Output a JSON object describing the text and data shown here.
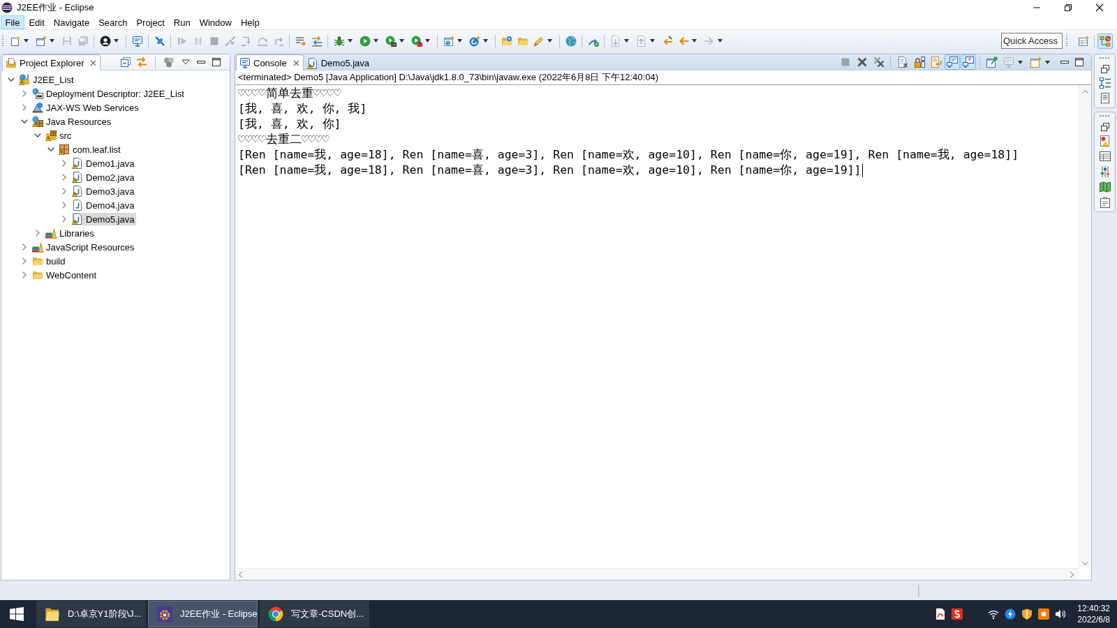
{
  "window": {
    "title": "J2EE作业 - Eclipse"
  },
  "menu": [
    {
      "label": "File",
      "selected": true
    },
    {
      "label": "Edit",
      "selected": false
    },
    {
      "label": "Navigate",
      "selected": false
    },
    {
      "label": "Search",
      "selected": false
    },
    {
      "label": "Project",
      "selected": false
    },
    {
      "label": "Run",
      "selected": false
    },
    {
      "label": "Window",
      "selected": false
    },
    {
      "label": "Help",
      "selected": false
    }
  ],
  "toolbar": {
    "buttons": [
      {
        "disabled": false
      },
      {
        "disabled": false
      },
      {
        "disabled": true
      },
      {
        "disabled": true
      },
      {
        "disabled": false
      },
      {
        "disabled": false
      },
      {
        "disabled": false
      },
      {
        "disabled": true
      },
      {
        "disabled": true
      },
      {
        "disabled": true
      },
      {
        "disabled": true
      },
      {
        "disabled": true
      },
      {
        "disabled": true
      },
      {
        "disabled": true
      },
      {
        "disabled": false
      },
      {
        "disabled": false
      },
      {
        "disabled": false
      },
      {
        "disabled": false
      },
      {
        "disabled": false
      },
      {
        "disabled": false
      },
      {
        "disabled": false
      },
      {
        "disabled": false
      },
      {
        "disabled": false
      },
      {
        "disabled": false
      },
      {
        "disabled": false
      },
      {
        "disabled": false
      },
      {
        "disabled": false
      },
      {
        "disabled": true
      },
      {
        "disabled": true
      },
      {
        "disabled": false
      },
      {
        "disabled": false
      },
      {
        "disabled": true
      }
    ],
    "quick_access": {
      "placeholder": "Quick Access"
    },
    "perspectives": [
      {
        "selected": false
      },
      {
        "selected": true
      }
    ]
  },
  "project_explorer": {
    "tabs": [
      {
        "label": "Project Explorer",
        "kind": "explorer",
        "warning": false,
        "selected": true
      }
    ],
    "tree": [
      {
        "label": "J2EE_List",
        "kind": "project",
        "warning": true,
        "expanded": true,
        "selected": false,
        "children": [
          {
            "label": "Deployment Descriptor: J2EE_List",
            "kind": "descriptor",
            "warning": false,
            "expanded": false,
            "selected": false
          },
          {
            "label": "JAX-WS Web Services",
            "kind": "services",
            "warning": false,
            "expanded": false,
            "selected": false
          },
          {
            "label": "Java Resources",
            "kind": "resources",
            "warning": true,
            "expanded": true,
            "selected": false,
            "children": [
              {
                "label": "src",
                "kind": "source",
                "warning": true,
                "expanded": true,
                "selected": false,
                "children": [
                  {
                    "label": "com.leaf.list",
                    "kind": "package",
                    "warning": true,
                    "expanded": true,
                    "selected": false,
                    "children": [
                      {
                        "label": "Demo1.java",
                        "kind": "file",
                        "warning": true,
                        "expanded": false,
                        "selected": false
                      },
                      {
                        "label": "Demo2.java",
                        "kind": "file",
                        "warning": true,
                        "expanded": false,
                        "selected": false
                      },
                      {
                        "label": "Demo3.java",
                        "kind": "file",
                        "warning": true,
                        "expanded": false,
                        "selected": false
                      },
                      {
                        "label": "Demo4.java",
                        "kind": "file",
                        "warning": false,
                        "expanded": false,
                        "selected": false
                      },
                      {
                        "label": "Demo5.java",
                        "kind": "file",
                        "warning": true,
                        "expanded": false,
                        "selected": true
                      }
                    ]
                  }
                ]
              },
              {
                "label": "Libraries",
                "kind": "library",
                "warning": false,
                "expanded": false,
                "selected": false
              }
            ]
          },
          {
            "label": "JavaScript Resources",
            "kind": "library",
            "warning": false,
            "expanded": false,
            "selected": false
          },
          {
            "label": "build",
            "kind": "folder",
            "warning": false,
            "expanded": false,
            "selected": false
          },
          {
            "label": "WebContent",
            "kind": "folder",
            "warning": false,
            "expanded": false,
            "selected": false
          }
        ]
      }
    ]
  },
  "console": {
    "tabs": [
      {
        "label": "Console",
        "kind": "console",
        "warning": false,
        "selected": true
      },
      {
        "label": "Demo5.java",
        "kind": "file",
        "warning": true,
        "selected": false
      }
    ],
    "toolbar": [
      {
        "disabled": true,
        "on": false
      },
      {
        "disabled": false,
        "on": false
      },
      {
        "disabled": false,
        "on": false
      },
      {
        "disabled": false,
        "on": false
      },
      {
        "disabled": false,
        "on": false
      },
      {
        "disabled": false,
        "on": false
      },
      {
        "disabled": false,
        "on": true
      },
      {
        "disabled": false,
        "on": true
      },
      {
        "disabled": false,
        "on": false
      },
      {
        "disabled": true,
        "on": false
      },
      {
        "disabled": false,
        "on": false
      }
    ],
    "description": "<terminated> Demo5 [Java Application] D:\\Java\\jdk1.8.0_73\\bin\\javaw.exe (2022年6月8日 下午12:40:04)",
    "lines": [
      "♡♡♡♡简单去重♡♡♡♡",
      "[我, 喜, 欢, 你, 我]",
      "[我, 喜, 欢, 你]",
      "♡♡♡♡去重二♡♡♡♡",
      "[Ren [name=我, age=18], Ren [name=喜, age=3], Ren [name=欢, age=10], Ren [name=你, age=19], Ren [name=我, age=18]]",
      "[Ren [name=我, age=18], Ren [name=喜, age=3], Ren [name=欢, age=10], Ren [name=你, age=19]]"
    ]
  },
  "taskbar": {
    "buttons": [
      {
        "label": "D:\\卓京Y1阶段\\J...",
        "kind": "folder",
        "selected": false
      },
      {
        "label": "J2EE作业 - Eclipse",
        "kind": "ide",
        "selected": true
      },
      {
        "label": "写文章-CSDN创...",
        "kind": "browser",
        "selected": false
      }
    ],
    "clock": {
      "time": "12:40:32",
      "date": "2022/6/8"
    }
  }
}
